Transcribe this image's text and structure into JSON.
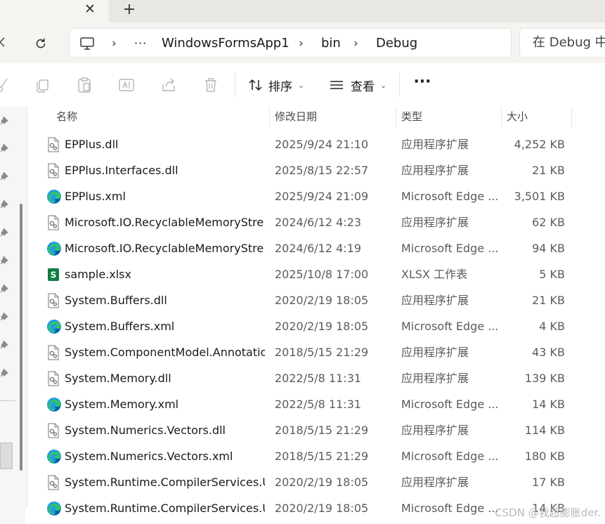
{
  "tabs": {
    "close_glyph": "✕",
    "new_glyph": "+"
  },
  "address": {
    "ellipsis": "···",
    "crumbs": [
      "WindowsFormsApp1",
      "bin",
      "Debug"
    ],
    "search_placeholder": "在 Debug 中搜索"
  },
  "commands": {
    "sort_label": "排序",
    "view_label": "查看",
    "more_glyph": "···"
  },
  "columns": {
    "name": "名称",
    "date": "修改日期",
    "type": "类型",
    "size": "大小"
  },
  "files": [
    {
      "name": "EPPlus.dll",
      "date": "2025/9/24 21:10",
      "type": "应用程序扩展",
      "size": "4,252 KB",
      "icon": "dll-file-icon"
    },
    {
      "name": "EPPlus.Interfaces.dll",
      "date": "2025/8/15 22:57",
      "type": "应用程序扩展",
      "size": "21 KB",
      "icon": "dll-file-icon"
    },
    {
      "name": "EPPlus.xml",
      "date": "2025/9/24 21:09",
      "type": "Microsoft Edge ...",
      "size": "3,501 KB",
      "icon": "edge-xml-icon"
    },
    {
      "name": "Microsoft.IO.RecyclableMemoryStre...",
      "date": "2024/6/12 4:23",
      "type": "应用程序扩展",
      "size": "62 KB",
      "icon": "dll-file-icon"
    },
    {
      "name": "Microsoft.IO.RecyclableMemoryStre...",
      "date": "2024/6/12 4:19",
      "type": "Microsoft Edge ...",
      "size": "94 KB",
      "icon": "edge-xml-icon"
    },
    {
      "name": "sample.xlsx",
      "date": "2025/10/8 17:00",
      "type": "XLSX 工作表",
      "size": "5 KB",
      "icon": "xlsx-file-icon"
    },
    {
      "name": "System.Buffers.dll",
      "date": "2020/2/19 18:05",
      "type": "应用程序扩展",
      "size": "21 KB",
      "icon": "dll-file-icon"
    },
    {
      "name": "System.Buffers.xml",
      "date": "2020/2/19 18:05",
      "type": "Microsoft Edge ...",
      "size": "4 KB",
      "icon": "edge-xml-icon"
    },
    {
      "name": "System.ComponentModel.Annotatio...",
      "date": "2018/5/15 21:29",
      "type": "应用程序扩展",
      "size": "43 KB",
      "icon": "dll-file-icon"
    },
    {
      "name": "System.Memory.dll",
      "date": "2022/5/8 11:31",
      "type": "应用程序扩展",
      "size": "139 KB",
      "icon": "dll-file-icon"
    },
    {
      "name": "System.Memory.xml",
      "date": "2022/5/8 11:31",
      "type": "Microsoft Edge ...",
      "size": "14 KB",
      "icon": "edge-xml-icon"
    },
    {
      "name": "System.Numerics.Vectors.dll",
      "date": "2018/5/15 21:29",
      "type": "应用程序扩展",
      "size": "114 KB",
      "icon": "dll-file-icon"
    },
    {
      "name": "System.Numerics.Vectors.xml",
      "date": "2018/5/15 21:29",
      "type": "Microsoft Edge ...",
      "size": "180 KB",
      "icon": "edge-xml-icon"
    },
    {
      "name": "System.Runtime.CompilerServices.U...",
      "date": "2020/2/19 18:05",
      "type": "应用程序扩展",
      "size": "17 KB",
      "icon": "dll-file-icon"
    },
    {
      "name": "System.Runtime.CompilerServices.U...",
      "date": "2020/2/19 18:05",
      "type": "Microsoft Edge ...",
      "size": "14 KB",
      "icon": "edge-xml-icon"
    }
  ],
  "watermark": "CSDN @我超膨胀der.",
  "colors": {
    "accent_blue": "#0f6cbd",
    "excel_green": "#107c41",
    "chrome_bg": "#f6f4f1"
  }
}
